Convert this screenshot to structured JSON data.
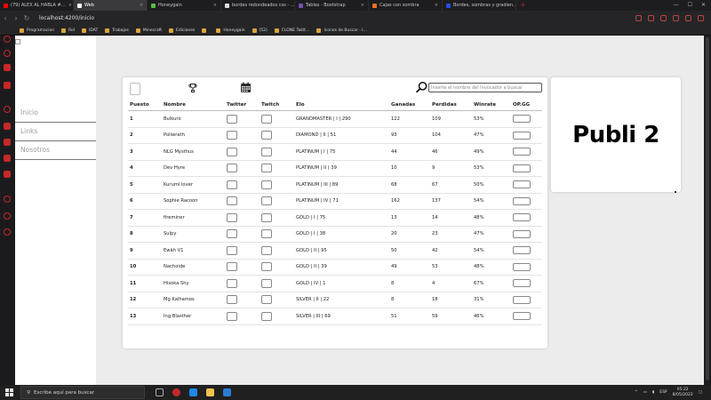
{
  "browser": {
    "tabs": [
      {
        "label": "(79) ALEX AL HABLA #…",
        "color": "#ff0000"
      },
      {
        "label": "Web",
        "color": "#ffffff",
        "active": true
      },
      {
        "label": "Honeygain",
        "color": "#55c043"
      },
      {
        "label": "bordes redondeados css - …",
        "color": "#dddddd"
      },
      {
        "label": "Tables · Bootstrap",
        "color": "#7952b3"
      },
      {
        "label": "Cajas con sombra",
        "color": "#f2711c"
      },
      {
        "label": "Bordes, sombras y gradien…",
        "color": "#264de4"
      }
    ],
    "new_tab": "+",
    "url": "localhost:4200/inicio",
    "bookmarks": [
      "Programacion",
      "Rol",
      "IDAT",
      "Trabajos",
      "Minecraft",
      "Ediciones",
      "",
      "Honeygain",
      "(52)",
      "CLONE Twitt…",
      "Iconos de Buscar - I…"
    ]
  },
  "site_nav": {
    "items": [
      "Inicio",
      "Links",
      "Nosotros"
    ]
  },
  "search": {
    "placeholder": "Inserte el nombre del Invocador a buscar"
  },
  "table": {
    "headers": [
      "Puesto",
      "Nombre",
      "Twitter",
      "Twitch",
      "Elo",
      "Ganadas",
      "Perdidas",
      "Winrate",
      "OP.GG"
    ],
    "rows": [
      {
        "puesto": "1",
        "nombre": "Bulkuro",
        "elo": "GRANDMASTER | I | 290",
        "ganadas": "122",
        "perdidas": "109",
        "winrate": "53%"
      },
      {
        "puesto": "2",
        "nombre": "Poliwrath",
        "elo": "DIAMOND | II | 51",
        "ganadas": "93",
        "perdidas": "104",
        "winrate": "47%"
      },
      {
        "puesto": "3",
        "nombre": "NLG Mysthus",
        "elo": "PLATINUM | I | 75",
        "ganadas": "44",
        "perdidas": "46",
        "winrate": "49%"
      },
      {
        "puesto": "4",
        "nombre": "Dev Hyre",
        "elo": "PLATINUM | II | 39",
        "ganadas": "10",
        "perdidas": "9",
        "winrate": "53%"
      },
      {
        "puesto": "5",
        "nombre": "Kurumi lover",
        "elo": "PLATINUM | III | 89",
        "ganadas": "68",
        "perdidas": "67",
        "winrate": "50%"
      },
      {
        "puesto": "6",
        "nombre": "Sophie Racoon",
        "elo": "PLATINUM | IV | 71",
        "ganadas": "162",
        "perdidas": "137",
        "winrate": "54%"
      },
      {
        "puesto": "7",
        "nombre": "fireminer",
        "elo": "GOLD | I | 75",
        "ganadas": "13",
        "perdidas": "14",
        "winrate": "48%"
      },
      {
        "puesto": "8",
        "nombre": "Sulpy",
        "elo": "GOLD | I | 38",
        "ganadas": "20",
        "perdidas": "23",
        "winrate": "47%"
      },
      {
        "puesto": "9",
        "nombre": "Ewäh V1",
        "elo": "GOLD | II | 95",
        "ganadas": "50",
        "perdidas": "42",
        "winrate": "54%"
      },
      {
        "puesto": "10",
        "nombre": "Nachoide",
        "elo": "GOLD | II | 39",
        "ganadas": "49",
        "perdidas": "53",
        "winrate": "48%"
      },
      {
        "puesto": "11",
        "nombre": "Hisoka Shy",
        "elo": "GOLD | IV | 1",
        "ganadas": "8",
        "perdidas": "4",
        "winrate": "67%"
      },
      {
        "puesto": "12",
        "nombre": "Mg Kalhamos",
        "elo": "SILVER | II | 22",
        "ganadas": "8",
        "perdidas": "18",
        "winrate": "31%"
      },
      {
        "puesto": "13",
        "nombre": "Ing Blasther",
        "elo": "SILVER | III | 69",
        "ganadas": "51",
        "perdidas": "59",
        "winrate": "46%"
      }
    ]
  },
  "ad": {
    "text": "Publi 2"
  },
  "taskbar": {
    "search_placeholder": "Escribe aquí para buscar",
    "lang": "ESP",
    "time": "05:22",
    "date": "8/05/2022"
  }
}
